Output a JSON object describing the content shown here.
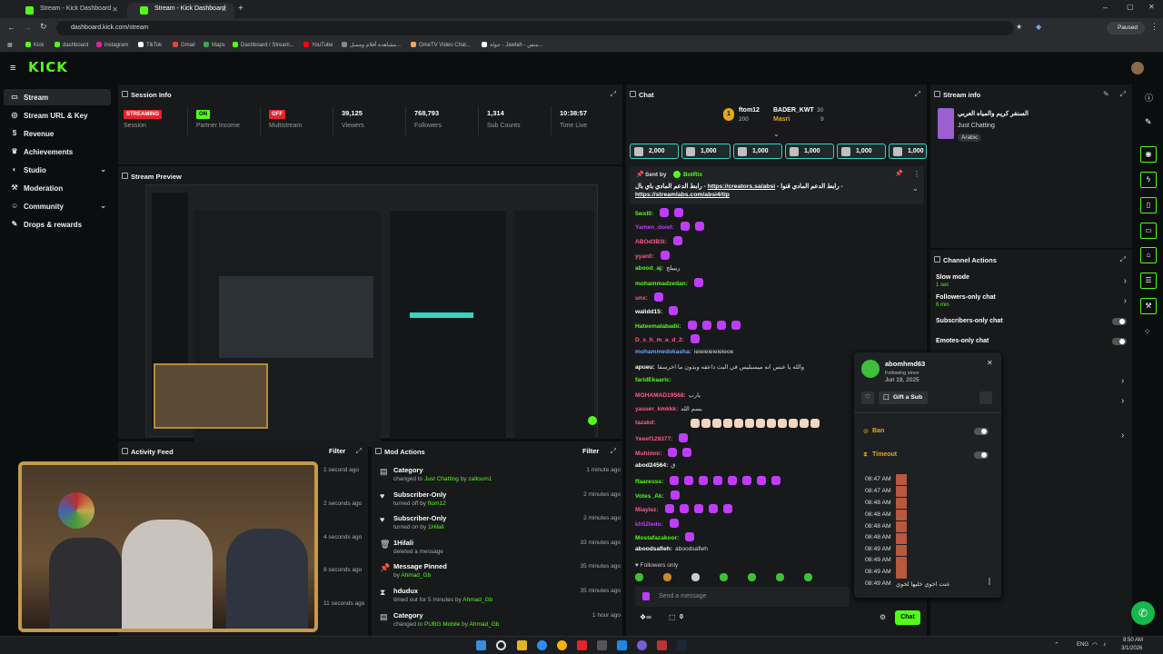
{
  "browser": {
    "tabs": [
      {
        "title": "Stream - Kick Dashboard"
      },
      {
        "title": "Stream - Kick Dashboard"
      }
    ],
    "url": "dashboard.kick.com/stream",
    "profile_status": "Paused",
    "bookmarks": [
      "Kick",
      "dashboard",
      "instagram",
      "TikTok",
      "Gmail",
      "Maps",
      "Dashboard / Stream...",
      "YouTube",
      "مشاهدة أفلام ومسل...",
      "OmeTV Video Chat...",
      "جولة - Jawlah - منص..."
    ]
  },
  "app": {
    "logo": "KICK"
  },
  "sidebar": {
    "items": [
      {
        "label": "Stream",
        "icon": "video-icon"
      },
      {
        "label": "Stream URL & Key",
        "icon": "globe-icon"
      },
      {
        "label": "Revenue",
        "icon": "dollar-icon"
      },
      {
        "label": "Achievements",
        "icon": "trophy-icon"
      },
      {
        "label": "Studio",
        "icon": "studio-icon"
      },
      {
        "label": "Moderation",
        "icon": "wrench-icon"
      },
      {
        "label": "Community",
        "icon": "community-icon"
      },
      {
        "label": "Drops & rewards",
        "icon": "gift-icon"
      }
    ]
  },
  "session": {
    "title": "Session Info",
    "stats": [
      {
        "value": "STREAMING",
        "label": "Session"
      },
      {
        "value": "ON",
        "label": "Partner Income"
      },
      {
        "value": "OFF",
        "label": "Multistream"
      },
      {
        "value": "39,125",
        "label": "Viewers"
      },
      {
        "value": "768,793",
        "label": "Followers"
      },
      {
        "value": "1,314",
        "label": "Sub Counts"
      },
      {
        "value": "10:38:57",
        "label": "Time Live"
      }
    ]
  },
  "preview": {
    "title": "Stream Preview"
  },
  "activity": {
    "title": "Activity Feed",
    "filter": "Filter",
    "times": [
      "1 second ago",
      "2 seconds ago",
      "4 seconds ago",
      "8 seconds ago",
      "11 seconds ago"
    ]
  },
  "mod_actions": {
    "title": "Mod Actions",
    "filter": "Filter",
    "items": [
      {
        "title": "Category",
        "sub": "changed to",
        "hl": "Just Chatting",
        "by": "by",
        "user": "zalloum1",
        "time": "1 minute ago",
        "icon": "category-icon"
      },
      {
        "title": "Subscriber-Only",
        "sub": "turned off by",
        "hl": "",
        "by": "",
        "user": "ftom12",
        "time": "2 minutes ago",
        "icon": "subscriber-icon"
      },
      {
        "title": "Subscriber-Only",
        "sub": "turned on by",
        "hl": "",
        "by": "",
        "user": "1Hilali",
        "time": "2 minutes ago",
        "icon": "subscriber-icon"
      },
      {
        "title": "1Hilali",
        "sub": "deleted a message",
        "hl": "",
        "by": "",
        "user": "",
        "time": "33 minutes ago",
        "icon": "trash-icon"
      },
      {
        "title": "Message Pinned",
        "sub": "by",
        "hl": "",
        "by": "",
        "user": "Ahmad_Gb",
        "time": "35 minutes ago",
        "icon": "pin-icon"
      },
      {
        "title": "hdudux",
        "sub": "timed out for 5 minutes by",
        "hl": "",
        "by": "",
        "user": "Ahmad_Gb",
        "time": "35 minutes ago",
        "icon": "hourglass-icon"
      },
      {
        "title": "Category",
        "sub": "changed to",
        "hl": "PUBG Mobile",
        "by": "by",
        "user": "Ahmad_Gb",
        "time": "1 hour ago",
        "icon": "category-icon"
      }
    ]
  },
  "chat": {
    "title": "Chat",
    "leaderboard": [
      {
        "name": "ftom12",
        "count": "200"
      },
      {
        "name": "BADER_KWT",
        "count": "30"
      },
      {
        "name": "Masri",
        "count": "9"
      }
    ],
    "gifts": [
      "2,000",
      "1,000",
      "1,000",
      "1,000",
      "1,000",
      "1,000"
    ],
    "pinned": {
      "sent_by": "Sent by",
      "bot": "BotRix",
      "text1": "رابط الدعم المادي باي بال - ",
      "link1": "https://creators.sa/absi",
      "text2": " - رابط الدعم المادي قنوا - ",
      "link2": "https://streamlabs.com/absi4/tip"
    },
    "messages": [
      {
        "user": "5wxl0:",
        "text": "",
        "color": "#53fc18"
      },
      {
        "user": "Yamen_doiel:",
        "text": "",
        "color": "#c03cff"
      },
      {
        "user": "ABOd3B3l:",
        "text": "",
        "color": "#ff5a8c"
      },
      {
        "user": "yyan0:",
        "text": "",
        "color": "#ff5a8c"
      },
      {
        "user": "abood_aj:",
        "text": "ريبيلج",
        "color": "#53fc18"
      },
      {
        "user": "mohammadzedan:",
        "text": "",
        "color": "#53fc18"
      },
      {
        "user": "unx:",
        "text": "",
        "color": "#ff5a8c"
      },
      {
        "user": "walidd15:",
        "text": "",
        "color": "#ffffff"
      },
      {
        "user": "Hateemalabadii:",
        "text": "",
        "color": "#53fc18"
      },
      {
        "user": "D_s_h_m_a_d_2:",
        "text": "",
        "color": "#ff5a8c"
      },
      {
        "user": "mohammedokasha:",
        "text": "ieieieieieieieoe",
        "color": "#6ba8ff"
      },
      {
        "user": "apueu:",
        "text": "والله يا عبس انه ميسبليس في البث داعقه وبدون ما اخرسقا",
        "color": "#ffffff"
      },
      {
        "user": "faridEkaaric:",
        "text": "",
        "color": "#53fc18"
      },
      {
        "user": "MOHAMAD19568:",
        "text": "يارب",
        "color": "#ff5a8c"
      },
      {
        "user": "yasser_kmkkk:",
        "text": "بسم الله",
        "color": "#ff5a8c"
      },
      {
        "user": "tazakd:",
        "text": "",
        "color": "#ff5a8c"
      },
      {
        "user": "Yeeef128377:",
        "text": "",
        "color": "#ff5a8c"
      },
      {
        "user": "Muhimni:",
        "text": "",
        "color": "#ff5a8c"
      },
      {
        "user": "abod24564:",
        "text": "ق",
        "color": "#ffffff"
      },
      {
        "user": "ffaaresss:",
        "text": "",
        "color": "#53fc18"
      },
      {
        "user": "Votes_Ak:",
        "text": "",
        "color": "#53fc18"
      },
      {
        "user": "Miaylez:",
        "text": "",
        "color": "#ff5a8c"
      },
      {
        "user": "kh52iedo:",
        "text": "",
        "color": "#c03cff"
      },
      {
        "user": "Mostafazakoor:",
        "text": "",
        "color": "#53fc18"
      },
      {
        "user": "aboodsafieh:",
        "text": "aboodsafieh",
        "color": "#ffffff"
      }
    ],
    "followers_only": "Followers only",
    "placeholder": "Send a message",
    "counts": [
      "0",
      "0"
    ],
    "send": "Chat"
  },
  "stream_info": {
    "title": "Stream info",
    "stream_title": "السنفر كريم والمياه العربي",
    "category": "Just Chatting",
    "tag": "Arabic"
  },
  "channel_actions": {
    "title": "Channel Actions",
    "items": [
      {
        "label": "Slow mode",
        "sub": "1 sec",
        "type": "arrow"
      },
      {
        "label": "Followers-only chat",
        "sub": "6 min",
        "type": "arrow"
      },
      {
        "label": "Subscribers-only chat",
        "sub": "",
        "type": "toggle"
      },
      {
        "label": "Emotes-only chat",
        "sub": "",
        "type": "toggle"
      }
    ]
  },
  "user_popup": {
    "username": "abomhmd63",
    "following_since": "Following since",
    "date": "Jun 19, 2025",
    "gift_sub": "Gift a Sub",
    "ban": "Ban",
    "timeout": "Timeout",
    "times": [
      "08:47 AM",
      "08:47 AM",
      "08:48 AM",
      "08:48 AM",
      "08:48 AM",
      "08:48 AM",
      "08:49 AM",
      "08:49 AM",
      "08:49 AM",
      "08:49 AM",
      "08:49 AM"
    ],
    "last_msg": "غنت اخوي خليها لخوي"
  },
  "taskbar": {
    "lang": "ENG",
    "time": "8:50 AM",
    "date": "3/1/2026"
  }
}
